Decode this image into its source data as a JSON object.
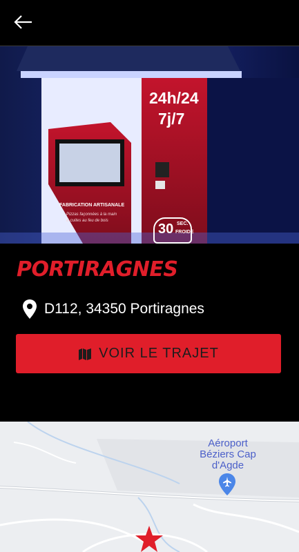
{
  "header": {
    "back_icon": "arrow-left-icon"
  },
  "hero": {
    "sign_hours": "24h/24",
    "sign_days": "7j/7",
    "machine_label": "FABRICATION ARTISANALE",
    "machine_sublabel_1": "Pizzas façonnées à la main",
    "machine_sublabel_2": "& cuites au feu de bois",
    "timer_value": "30",
    "timer_unit": "SEC.",
    "timer_sub": "FROIDE"
  },
  "location": {
    "title": "PORTIRAGNES",
    "address": "D112, 34350 Portiragnes",
    "address_icon": "map-pin-icon"
  },
  "action": {
    "label": "VOIR LE TRAJET",
    "icon": "map-icon"
  },
  "map": {
    "airport_label_1": "Aéroport",
    "airport_label_2": "Béziers Cap",
    "airport_label_3": "d'Agde",
    "airport_icon": "airplane-icon",
    "marker_icon": "star-icon"
  },
  "colors": {
    "accent": "#e01e2a",
    "background": "#000000"
  }
}
